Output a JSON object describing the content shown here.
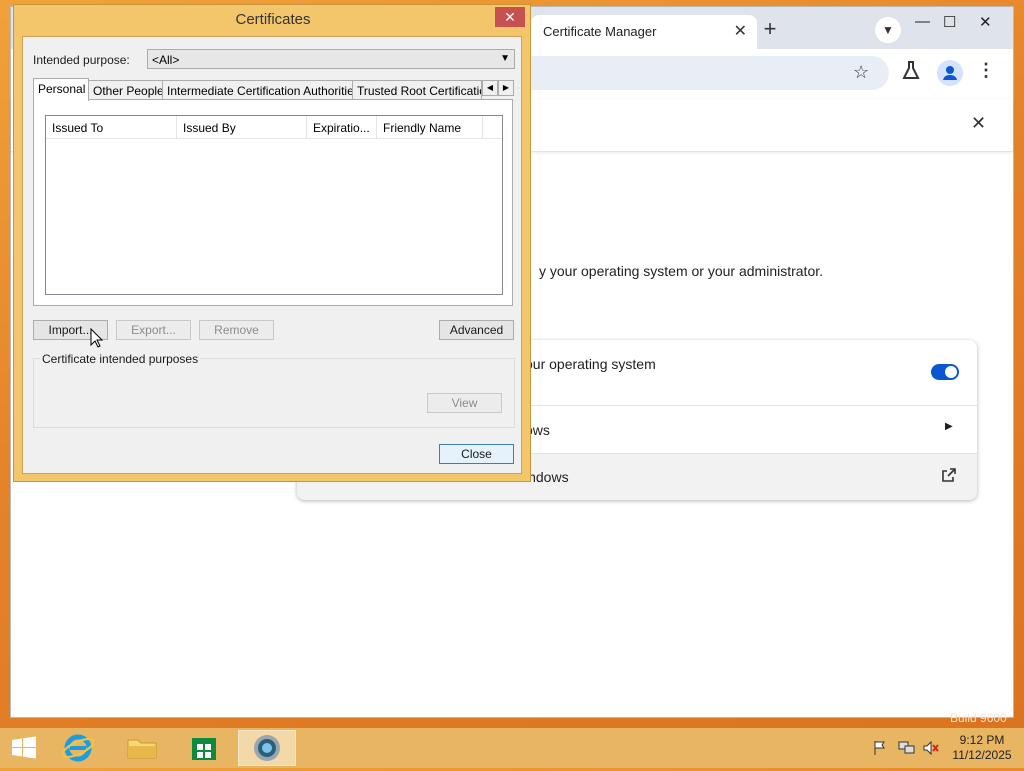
{
  "chrome": {
    "tab_title": "Certificate Manager",
    "tab_close": "✕",
    "new_tab": "+",
    "minimize": "—",
    "maximize": "☐",
    "close": "✕"
  },
  "page": {
    "description": "y your operating system or your administrator.",
    "rows": [
      {
        "label": "our operating system"
      },
      {
        "label": "ows"
      },
      {
        "label": "indows"
      }
    ],
    "toggle_on": true
  },
  "dialog": {
    "title": "Certificates",
    "close": "✕",
    "purpose_label": "Intended purpose:",
    "purpose_value": "<All>",
    "tabs": [
      {
        "label": "Personal"
      },
      {
        "label": "Other People"
      },
      {
        "label": "Intermediate Certification Authorities"
      },
      {
        "label": "Trusted Root Certification"
      }
    ],
    "columns": [
      {
        "label": "Issued To"
      },
      {
        "label": "Issued By"
      },
      {
        "label": "Expiratio..."
      },
      {
        "label": "Friendly Name"
      }
    ],
    "buttons": {
      "import": "Import...",
      "export": "Export...",
      "remove": "Remove",
      "advanced": "Advanced",
      "view": "View",
      "close": "Close"
    },
    "group_label": "Certificate intended purposes"
  },
  "taskbar": {
    "time": "9:12 PM",
    "date": "11/12/2025",
    "build": "Build 9600"
  }
}
